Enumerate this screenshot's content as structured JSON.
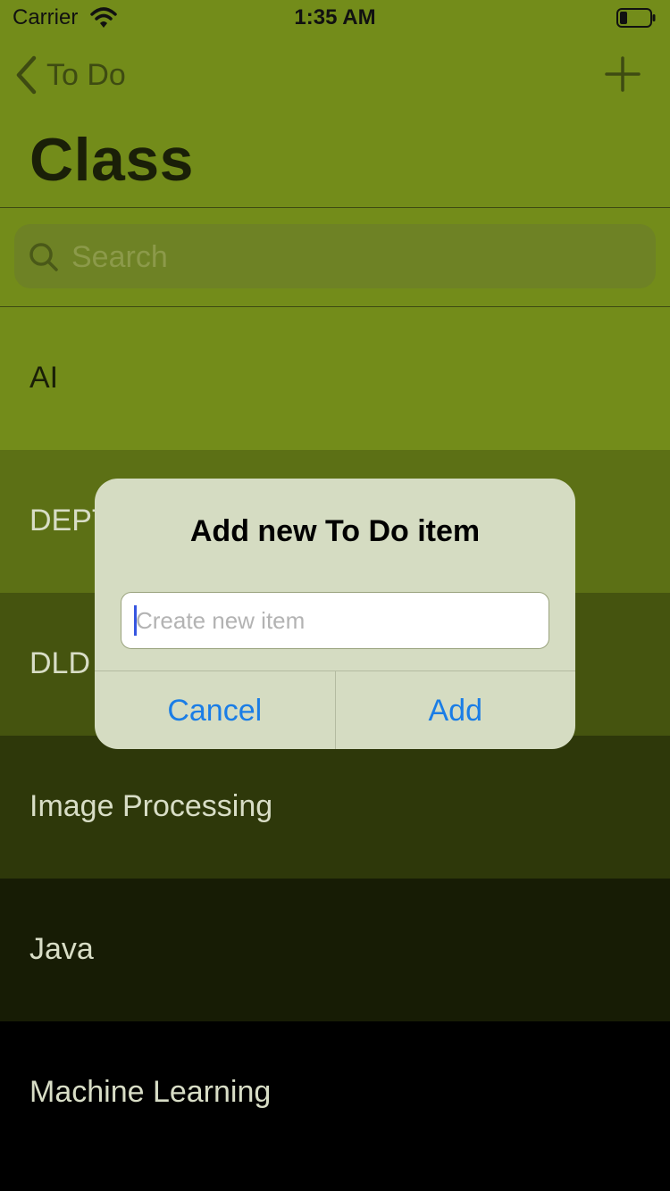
{
  "status_bar": {
    "carrier": "Carrier",
    "time": "1:35 AM",
    "wifi_icon": "wifi-icon",
    "battery_icon": "battery-icon"
  },
  "nav": {
    "back_label": "To Do",
    "back_icon": "chevron-left-icon",
    "add_icon": "plus-icon",
    "title": "Class"
  },
  "search": {
    "placeholder": "Search",
    "icon": "search-icon"
  },
  "list": {
    "items": [
      {
        "label": "AI",
        "bg": "#738c1a",
        "fg": "#1a1f08"
      },
      {
        "label": "DEPT",
        "bg": "#5c7015",
        "fg": "#d8ddc6"
      },
      {
        "label": "DLD",
        "bg": "#45540f",
        "fg": "#d8ddc6"
      },
      {
        "label": "Image Processing",
        "bg": "#2e380a",
        "fg": "#d8ddc6"
      },
      {
        "label": "Java",
        "bg": "#171c05",
        "fg": "#d8ddc6"
      },
      {
        "label": "Machine Learning",
        "bg": "#000000",
        "fg": "#d8ddc6"
      }
    ]
  },
  "alert": {
    "title": "Add new To Do item",
    "field_placeholder": "Create new item",
    "field_value": "",
    "cancel_label": "Cancel",
    "add_label": "Add",
    "button_color": "#1a7de6"
  },
  "colors": {
    "nav_bg": "#738c1a",
    "accent_text": "#3e4b12"
  }
}
